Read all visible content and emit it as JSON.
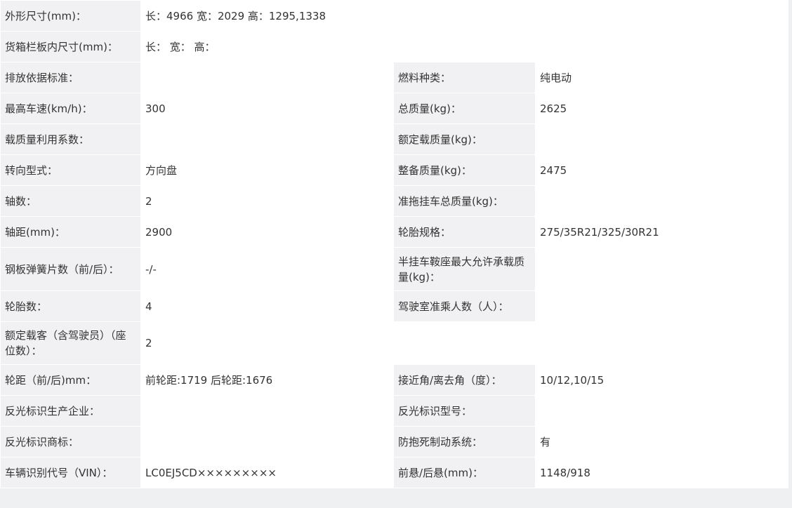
{
  "rows": [
    {
      "l1": "外形尺寸(mm)：",
      "v1": "长：4966 宽：2029 高：1295,1338",
      "span": true
    },
    {
      "l1": "货箱栏板内尺寸(mm)：",
      "v1": "长： 宽： 高：",
      "span": true
    },
    {
      "l1": "排放依据标准：",
      "v1": "",
      "l2": "燃料种类：",
      "v2": "纯电动"
    },
    {
      "l1": "最高车速(km/h)：",
      "v1": "300",
      "l2": "总质量(kg)：",
      "v2": "2625"
    },
    {
      "l1": "载质量利用系数：",
      "v1": "",
      "l2": "额定载质量(kg)：",
      "v2": ""
    },
    {
      "l1": "转向型式：",
      "v1": "方向盘",
      "l2": "整备质量(kg)：",
      "v2": "2475"
    },
    {
      "l1": "轴数：",
      "v1": "2",
      "l2": "准拖挂车总质量(kg)：",
      "v2": ""
    },
    {
      "l1": "轴距(mm)：",
      "v1": "2900",
      "l2": "轮胎规格：",
      "v2": "275/35R21/325/30R21"
    },
    {
      "l1": "钢板弹簧片数（前/后）：",
      "v1": "-/-",
      "l2": "半挂车鞍座最大允许承载质量(kg)：",
      "v2": ""
    },
    {
      "l1": "轮胎数：",
      "v1": "4",
      "l2": "驾驶室准乘人数（人）：",
      "v2": ""
    },
    {
      "l1": "额定载客（含驾驶员）（座位数）：",
      "v1": "2",
      "span": true
    },
    {
      "l1": "轮距（前/后)mm：",
      "v1": "前轮距:1719 后轮距:1676",
      "l2": "接近角/离去角（度）：",
      "v2": "10/12,10/15"
    },
    {
      "l1": "反光标识生产企业：",
      "v1": "",
      "l2": "反光标识型号：",
      "v2": ""
    },
    {
      "l1": "反光标识商标：",
      "v1": "",
      "l2": "防抱死制动系统：",
      "v2": "有"
    },
    {
      "l1": "车辆识别代号（VIN）：",
      "v1": "LC0EJ5CD×××××××××",
      "l2": "前悬/后悬(mm)：",
      "v2": "1148/918"
    }
  ]
}
